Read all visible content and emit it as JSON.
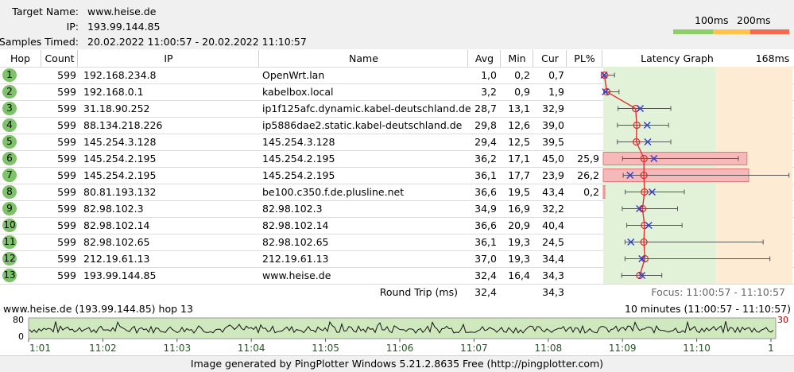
{
  "header": {
    "target_label": "Target Name:",
    "target_value": "www.heise.de",
    "ip_label": "IP:",
    "ip_value": "193.99.144.85",
    "samples_label": "Samples Timed:",
    "samples_value": "20.02.2022 11:00:57 - 20.02.2022 11:10:57",
    "threshold_1": "100ms",
    "threshold_2": "200ms",
    "colors": {
      "good": "#8fcf6a",
      "warn": "#ffc34d",
      "bad": "#f26a4f"
    }
  },
  "columns": {
    "hop": "Hop",
    "count": "Count",
    "ip": "IP",
    "name": "Name",
    "avg": "Avg",
    "min": "Min",
    "cur": "Cur",
    "pl": "PL%",
    "graph": "Latency Graph",
    "scale_max": "168ms"
  },
  "rows": [
    {
      "hop": "1",
      "count": "599",
      "ip": "192.168.234.8",
      "name": "OpenWrt.lan",
      "avg": "1,0",
      "min": "0,2",
      "cur": "0,7",
      "pl": "",
      "avg_v": 1.0,
      "min_v": 0.2,
      "cur_v": 0.7,
      "max_v": 10,
      "pl_v": 0
    },
    {
      "hop": "2",
      "count": "599",
      "ip": "192.168.0.1",
      "name": "kabelbox.local",
      "avg": "3,2",
      "min": "0,9",
      "cur": "1,9",
      "pl": "",
      "avg_v": 3.2,
      "min_v": 0.9,
      "cur_v": 1.9,
      "max_v": 14,
      "pl_v": 0
    },
    {
      "hop": "3",
      "count": "599",
      "ip": "31.18.90.252",
      "name": "ip1f125afc.dynamic.kabel-deutschland.de",
      "avg": "28,7",
      "min": "13,1",
      "cur": "32,9",
      "pl": "",
      "avg_v": 28.7,
      "min_v": 13.1,
      "cur_v": 32.9,
      "max_v": 60,
      "pl_v": 0
    },
    {
      "hop": "4",
      "count": "599",
      "ip": "88.134.218.226",
      "name": "ip5886dae2.static.kabel-deutschland.de",
      "avg": "29,8",
      "min": "12,6",
      "cur": "39,0",
      "pl": "",
      "avg_v": 29.8,
      "min_v": 12.6,
      "cur_v": 39.0,
      "max_v": 58,
      "pl_v": 0
    },
    {
      "hop": "5",
      "count": "599",
      "ip": "145.254.3.128",
      "name": "145.254.3.128",
      "avg": "29,4",
      "min": "12,5",
      "cur": "39,5",
      "pl": "",
      "avg_v": 29.4,
      "min_v": 12.5,
      "cur_v": 39.5,
      "max_v": 60,
      "pl_v": 0
    },
    {
      "hop": "6",
      "count": "599",
      "ip": "145.254.2.195",
      "name": "145.254.2.195",
      "avg": "36,2",
      "min": "17,1",
      "cur": "45,0",
      "pl": "25,9",
      "avg_v": 36.2,
      "min_v": 17.1,
      "cur_v": 45.0,
      "max_v": 120,
      "pl_v": 25.9
    },
    {
      "hop": "7",
      "count": "599",
      "ip": "145.254.2.195",
      "name": "145.254.2.195",
      "avg": "36,1",
      "min": "17,7",
      "cur": "23,9",
      "pl": "26,2",
      "avg_v": 36.1,
      "min_v": 17.7,
      "cur_v": 23.9,
      "max_v": 165,
      "pl_v": 26.2
    },
    {
      "hop": "8",
      "count": "599",
      "ip": "80.81.193.132",
      "name": "be100.c350.f.de.plusline.net",
      "avg": "36,6",
      "min": "19,5",
      "cur": "43,4",
      "pl": "0,2",
      "avg_v": 36.6,
      "min_v": 19.5,
      "cur_v": 43.4,
      "max_v": 72,
      "pl_v": 0.2
    },
    {
      "hop": "9",
      "count": "599",
      "ip": "82.98.102.3",
      "name": "82.98.102.3",
      "avg": "34,9",
      "min": "16,9",
      "cur": "32,2",
      "pl": "",
      "avg_v": 34.9,
      "min_v": 16.9,
      "cur_v": 32.2,
      "max_v": 66,
      "pl_v": 0
    },
    {
      "hop": "10",
      "count": "599",
      "ip": "82.98.102.14",
      "name": "82.98.102.14",
      "avg": "36,6",
      "min": "20,9",
      "cur": "40,4",
      "pl": "",
      "avg_v": 36.6,
      "min_v": 20.9,
      "cur_v": 40.4,
      "max_v": 70,
      "pl_v": 0
    },
    {
      "hop": "11",
      "count": "599",
      "ip": "82.98.102.65",
      "name": "82.98.102.65",
      "avg": "36,1",
      "min": "19,3",
      "cur": "24,5",
      "pl": "",
      "avg_v": 36.1,
      "min_v": 19.3,
      "cur_v": 24.5,
      "max_v": 142,
      "pl_v": 0
    },
    {
      "hop": "12",
      "count": "599",
      "ip": "212.19.61.13",
      "name": "212.19.61.13",
      "avg": "37,0",
      "min": "19,3",
      "cur": "34,4",
      "pl": "",
      "avg_v": 37.0,
      "min_v": 19.3,
      "cur_v": 34.4,
      "max_v": 148,
      "pl_v": 0
    },
    {
      "hop": "13",
      "count": "599",
      "ip": "193.99.144.85",
      "name": "www.heise.de",
      "avg": "32,4",
      "min": "16,4",
      "cur": "34,3",
      "pl": "",
      "avg_v": 32.4,
      "min_v": 16.4,
      "cur_v": 34.3,
      "max_v": 52,
      "pl_v": 0
    }
  ],
  "footer": {
    "round_trip_label": "Round Trip (ms)",
    "round_trip_avg": "32,4",
    "round_trip_cur": "34,3",
    "focus": "Focus: 11:00:57 - 11:10:57"
  },
  "mini_graph": {
    "title": "www.heise.de (193.99.144.85) hop 13",
    "range": "10 minutes (11:00:57 - 11:10:57)",
    "y_max": "80",
    "y_min": "0",
    "max_loss": "30",
    "time_labels": [
      "1:01",
      "11:02",
      "11:03",
      "11:04",
      "11:05",
      "11:06",
      "11:07",
      "11:08",
      "11:09",
      "11:10",
      "1"
    ]
  },
  "credit": "Image generated by PingPlotter Windows 5.21.2.8635 Free (http://pingplotter.com)"
}
